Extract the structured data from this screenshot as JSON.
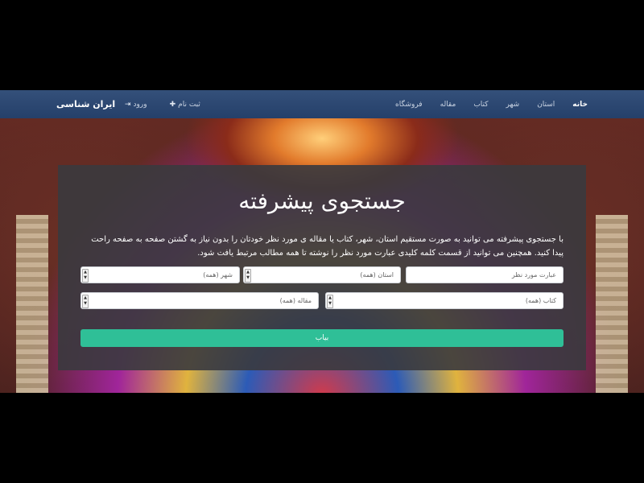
{
  "navbar": {
    "brand": "ایران شناسی",
    "login_label": "ورود",
    "signup_label": "ثبت نام",
    "login_icon": "sign-in-icon",
    "signup_icon": "user-plus-icon",
    "links": [
      "خانه",
      "استان",
      "شهر",
      "کتاب",
      "مقاله",
      "فروشگاه"
    ]
  },
  "search": {
    "title": "جستجوی پیشرفته",
    "description": "با جستجوی پیشرفته می توانید به صورت مستقیم استان، شهر، کتاب یا مقاله ی مورد نظر خودتان را بدون نیاز به گشتن صفحه به صفحه راحت پیدا کنید. همچنین می توانید از قسمت کلمه کلیدی عبارت مورد نظر را نوشته تا همه مطالب مرتبط یافت شود.",
    "keyword_placeholder": "عبارت مورد نظر",
    "province_select": "استان (همه)",
    "city_select": "شهر (همه)",
    "book_select": "کتاب (همه)",
    "article_select": "مقاله (همه)",
    "submit_label": "بیاب"
  },
  "colors": {
    "navbar": "#2c4a75",
    "button": "#2fbf97",
    "panel": "#3a3a3e"
  }
}
